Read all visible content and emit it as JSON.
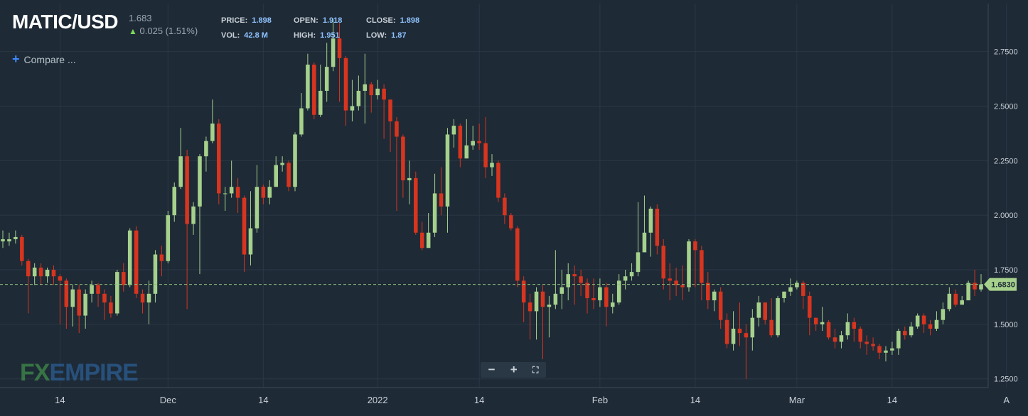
{
  "header": {
    "symbol": "MATIC/USD",
    "last_price": "1.683",
    "change": "0.025 (1.51%)",
    "stats": [
      {
        "label": "PRICE:",
        "value": "1.898"
      },
      {
        "label": "OPEN:",
        "value": "1.918"
      },
      {
        "label": "CLOSE:",
        "value": "1.898"
      },
      {
        "label": "VOL:",
        "value": "42.8 M"
      },
      {
        "label": "HIGH:",
        "value": "1.951"
      },
      {
        "label": "LOW:",
        "value": "1.87"
      }
    ],
    "compare_label": "Compare ..."
  },
  "logo": {
    "fx": "FX",
    "empire": "EMPIRE"
  },
  "zoom": {
    "minus": "−",
    "plus": "+",
    "fit": "⛶"
  },
  "colors": {
    "up": "#a6d18c",
    "down": "#d7351f",
    "grid": "#2b3845",
    "axis_text": "#c8d0d8",
    "price_line": "#8ec07c"
  },
  "chart_data": {
    "type": "candlestick",
    "current_price": 1.683,
    "current_price_label": "1.6830",
    "ylim": [
      1.21,
      2.97
    ],
    "yticks": [
      1.25,
      1.5,
      1.75,
      2.0,
      2.25,
      2.5,
      2.75
    ],
    "ytick_labels": [
      "1.2500",
      "1.5000",
      "1.7500",
      "2.0000",
      "2.2500",
      "2.5000",
      "2.7500"
    ],
    "xtick_labels": [
      {
        "label": "14",
        "index": 9
      },
      {
        "label": "Dec",
        "index": 26
      },
      {
        "label": "14",
        "index": 41
      },
      {
        "label": "2022",
        "index": 59
      },
      {
        "label": "14",
        "index": 75
      },
      {
        "label": "Feb",
        "index": 94
      },
      {
        "label": "14",
        "index": 109
      },
      {
        "label": "Mar",
        "index": 125
      },
      {
        "label": "14",
        "index": 140
      },
      {
        "label": "A",
        "index": 158
      }
    ],
    "candles": [
      [
        1.88,
        1.89,
        1.93,
        1.85
      ],
      [
        1.88,
        1.89,
        1.92,
        1.86
      ],
      [
        1.89,
        1.9,
        1.93,
        1.87
      ],
      [
        1.9,
        1.79,
        1.91,
        1.77
      ],
      [
        1.79,
        1.72,
        1.8,
        1.55
      ],
      [
        1.72,
        1.76,
        1.78,
        1.68
      ],
      [
        1.76,
        1.72,
        1.78,
        1.68
      ],
      [
        1.72,
        1.75,
        1.76,
        1.69
      ],
      [
        1.75,
        1.72,
        1.77,
        1.68
      ],
      [
        1.72,
        1.7,
        1.73,
        1.5
      ],
      [
        1.7,
        1.58,
        1.71,
        1.48
      ],
      [
        1.58,
        1.66,
        1.68,
        1.49
      ],
      [
        1.66,
        1.54,
        1.68,
        1.46
      ],
      [
        1.54,
        1.64,
        1.66,
        1.48
      ],
      [
        1.64,
        1.68,
        1.7,
        1.6
      ],
      [
        1.68,
        1.64,
        1.69,
        1.58
      ],
      [
        1.64,
        1.6,
        1.66,
        1.52
      ],
      [
        1.6,
        1.55,
        1.63,
        1.53
      ],
      [
        1.55,
        1.74,
        1.75,
        1.54
      ],
      [
        1.74,
        1.68,
        1.78,
        1.65
      ],
      [
        1.68,
        1.93,
        1.94,
        1.67
      ],
      [
        1.93,
        1.64,
        1.95,
        1.62
      ],
      [
        1.64,
        1.6,
        1.66,
        1.55
      ],
      [
        1.6,
        1.64,
        1.7,
        1.5
      ],
      [
        1.64,
        1.82,
        1.84,
        1.6
      ],
      [
        1.82,
        1.79,
        1.86,
        1.72
      ],
      [
        1.79,
        2.0,
        2.02,
        1.78
      ],
      [
        2.0,
        2.13,
        2.15,
        1.97
      ],
      [
        2.13,
        2.27,
        2.4,
        2.12
      ],
      [
        2.27,
        1.96,
        2.3,
        1.57
      ],
      [
        1.96,
        2.04,
        2.06,
        1.91
      ],
      [
        2.04,
        2.27,
        2.28,
        1.73
      ],
      [
        2.27,
        2.34,
        2.36,
        2.2
      ],
      [
        2.34,
        2.42,
        2.53,
        2.33
      ],
      [
        2.42,
        2.1,
        2.44,
        2.05
      ],
      [
        2.1,
        2.1,
        2.13,
        2.02
      ],
      [
        2.1,
        2.13,
        2.25,
        2.08
      ],
      [
        2.13,
        2.08,
        2.17,
        2.01
      ],
      [
        2.08,
        1.82,
        2.09,
        1.74
      ],
      [
        1.82,
        1.94,
        2.11,
        1.77
      ],
      [
        1.94,
        2.13,
        2.23,
        1.92
      ],
      [
        2.13,
        2.08,
        2.14,
        2.05
      ],
      [
        2.08,
        2.13,
        2.16,
        2.05
      ],
      [
        2.13,
        2.23,
        2.27,
        2.19
      ],
      [
        2.23,
        2.24,
        2.27,
        2.2
      ],
      [
        2.24,
        2.13,
        2.25,
        2.11
      ],
      [
        2.13,
        2.37,
        2.38,
        2.11
      ],
      [
        2.37,
        2.49,
        2.56,
        2.36
      ],
      [
        2.49,
        2.69,
        2.74,
        2.48
      ],
      [
        2.69,
        2.46,
        2.7,
        2.44
      ],
      [
        2.46,
        2.57,
        2.69,
        2.45
      ],
      [
        2.57,
        2.68,
        2.79,
        2.52
      ],
      [
        2.68,
        2.81,
        2.9,
        2.66
      ],
      [
        2.81,
        2.72,
        2.88,
        2.52
      ],
      [
        2.72,
        2.48,
        2.73,
        2.41
      ],
      [
        2.48,
        2.5,
        2.62,
        2.43
      ],
      [
        2.5,
        2.57,
        2.64,
        2.48
      ],
      [
        2.57,
        2.6,
        2.74,
        2.42
      ],
      [
        2.6,
        2.55,
        2.61,
        2.47
      ],
      [
        2.55,
        2.58,
        2.62,
        2.53
      ],
      [
        2.58,
        2.53,
        2.6,
        2.35
      ],
      [
        2.53,
        2.43,
        2.47,
        2.29
      ],
      [
        2.43,
        2.36,
        2.45,
        2.02
      ],
      [
        2.36,
        2.16,
        2.37,
        2.08
      ],
      [
        2.16,
        2.17,
        2.25,
        2.05
      ],
      [
        2.17,
        1.92,
        2.2,
        1.91
      ],
      [
        1.92,
        1.85,
        1.97,
        1.84
      ],
      [
        1.85,
        1.92,
        2.01,
        1.86
      ],
      [
        1.92,
        2.1,
        2.19,
        1.9
      ],
      [
        2.1,
        2.04,
        2.22,
        2.0
      ],
      [
        2.04,
        2.37,
        2.4,
        1.92
      ],
      [
        2.37,
        2.41,
        2.44,
        2.31
      ],
      [
        2.41,
        2.26,
        2.42,
        2.22
      ],
      [
        2.26,
        2.32,
        2.44,
        2.28
      ],
      [
        2.32,
        2.34,
        2.41,
        2.3
      ],
      [
        2.34,
        2.33,
        2.42,
        2.3
      ],
      [
        2.33,
        2.22,
        2.45,
        2.17
      ],
      [
        2.22,
        2.24,
        2.28,
        2.18
      ],
      [
        2.24,
        2.08,
        2.25,
        2.06
      ],
      [
        2.08,
        2.0,
        2.1,
        1.96
      ],
      [
        2.0,
        1.94,
        2.01,
        1.93
      ],
      [
        1.94,
        1.7,
        1.95,
        1.67
      ],
      [
        1.7,
        1.6,
        1.72,
        1.51
      ],
      [
        1.6,
        1.56,
        1.64,
        1.43
      ],
      [
        1.56,
        1.65,
        1.67,
        1.43
      ],
      [
        1.65,
        1.58,
        1.68,
        1.34
      ],
      [
        1.58,
        1.59,
        1.63,
        1.44
      ],
      [
        1.59,
        1.64,
        1.84,
        1.57
      ],
      [
        1.64,
        1.67,
        1.75,
        1.57
      ],
      [
        1.67,
        1.73,
        1.78,
        1.61
      ],
      [
        1.73,
        1.72,
        1.77,
        1.59
      ],
      [
        1.72,
        1.69,
        1.75,
        1.63
      ],
      [
        1.69,
        1.62,
        1.71,
        1.55
      ],
      [
        1.62,
        1.61,
        1.71,
        1.57
      ],
      [
        1.61,
        1.67,
        1.71,
        1.58
      ],
      [
        1.67,
        1.58,
        1.69,
        1.49
      ],
      [
        1.58,
        1.6,
        1.64,
        1.55
      ],
      [
        1.6,
        1.7,
        1.73,
        1.59
      ],
      [
        1.7,
        1.72,
        1.75,
        1.66
      ],
      [
        1.72,
        1.74,
        1.78,
        1.7
      ],
      [
        1.74,
        1.83,
        2.06,
        1.72
      ],
      [
        1.83,
        1.92,
        2.09,
        1.87
      ],
      [
        1.92,
        2.03,
        2.04,
        1.81
      ],
      [
        2.03,
        1.86,
        2.05,
        1.82
      ],
      [
        1.86,
        1.71,
        1.89,
        1.66
      ],
      [
        1.71,
        1.7,
        1.78,
        1.61
      ],
      [
        1.7,
        1.68,
        1.76,
        1.63
      ],
      [
        1.68,
        1.67,
        1.77,
        1.61
      ],
      [
        1.67,
        1.88,
        1.89,
        1.65
      ],
      [
        1.88,
        1.84,
        1.89,
        1.67
      ],
      [
        1.84,
        1.69,
        1.86,
        1.61
      ],
      [
        1.69,
        1.61,
        1.74,
        1.57
      ],
      [
        1.61,
        1.65,
        1.66,
        1.56
      ],
      [
        1.65,
        1.52,
        1.67,
        1.48
      ],
      [
        1.52,
        1.41,
        1.55,
        1.39
      ],
      [
        1.41,
        1.48,
        1.56,
        1.38
      ],
      [
        1.48,
        1.46,
        1.6,
        1.4
      ],
      [
        1.46,
        1.44,
        1.5,
        1.25
      ],
      [
        1.44,
        1.53,
        1.57,
        1.38
      ],
      [
        1.53,
        1.6,
        1.63,
        1.49
      ],
      [
        1.6,
        1.52,
        1.6,
        1.5
      ],
      [
        1.52,
        1.45,
        1.62,
        1.44
      ],
      [
        1.45,
        1.62,
        1.63,
        1.44
      ],
      [
        1.62,
        1.65,
        1.65,
        1.6
      ],
      [
        1.65,
        1.67,
        1.71,
        1.63
      ],
      [
        1.67,
        1.69,
        1.7,
        1.66
      ],
      [
        1.69,
        1.63,
        1.7,
        1.57
      ],
      [
        1.63,
        1.53,
        1.65,
        1.45
      ],
      [
        1.53,
        1.5,
        1.53,
        1.47
      ],
      [
        1.5,
        1.51,
        1.58,
        1.47
      ],
      [
        1.51,
        1.44,
        1.52,
        1.43
      ],
      [
        1.44,
        1.42,
        1.48,
        1.39
      ],
      [
        1.42,
        1.45,
        1.47,
        1.39
      ],
      [
        1.45,
        1.51,
        1.55,
        1.43
      ],
      [
        1.51,
        1.48,
        1.53,
        1.42
      ],
      [
        1.48,
        1.42,
        1.49,
        1.39
      ],
      [
        1.42,
        1.41,
        1.45,
        1.36
      ],
      [
        1.41,
        1.4,
        1.44,
        1.38
      ],
      [
        1.4,
        1.37,
        1.41,
        1.34
      ],
      [
        1.37,
        1.38,
        1.4,
        1.33
      ],
      [
        1.38,
        1.39,
        1.42,
        1.36
      ],
      [
        1.39,
        1.47,
        1.48,
        1.36
      ],
      [
        1.47,
        1.45,
        1.49,
        1.43
      ],
      [
        1.45,
        1.49,
        1.51,
        1.44
      ],
      [
        1.49,
        1.54,
        1.55,
        1.48
      ],
      [
        1.54,
        1.5,
        1.55,
        1.46
      ],
      [
        1.5,
        1.48,
        1.52,
        1.45
      ],
      [
        1.48,
        1.52,
        1.56,
        1.47
      ],
      [
        1.52,
        1.57,
        1.6,
        1.5
      ],
      [
        1.57,
        1.64,
        1.67,
        1.56
      ],
      [
        1.64,
        1.59,
        1.66,
        1.58
      ],
      [
        1.59,
        1.61,
        1.63,
        1.59
      ],
      [
        1.61,
        1.69,
        1.7,
        1.61
      ],
      [
        1.69,
        1.66,
        1.75,
        1.63
      ],
      [
        1.66,
        1.683,
        1.73,
        1.65
      ]
    ]
  }
}
